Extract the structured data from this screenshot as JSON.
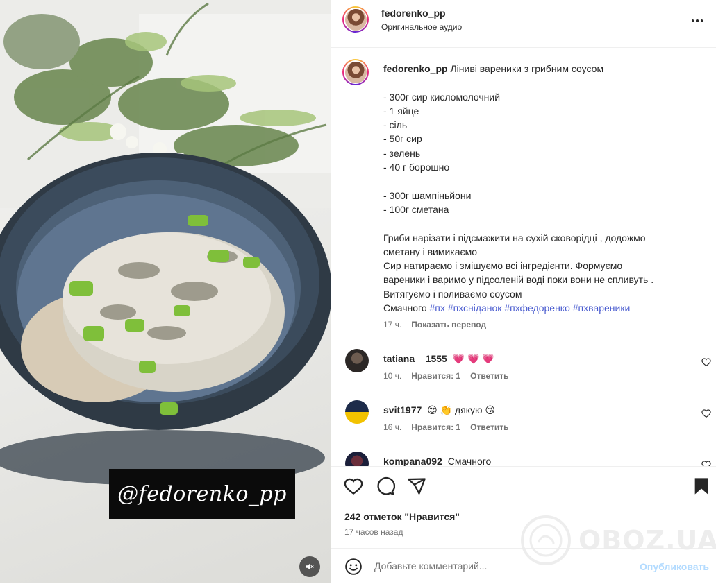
{
  "media": {
    "watermark": "@fedorenko_pp",
    "mute_icon": "speaker-muted-icon"
  },
  "header": {
    "username": "fedorenko_pp",
    "subline": "Оригинальное аудио",
    "more_icon": "more-horizontal-icon"
  },
  "caption": {
    "username": "fedorenko_pp",
    "title": "Ліниві вареники з грибним соусом",
    "lines": [
      "",
      "- 300г сир кисломолочний",
      "- 1 яйце",
      "- сіль",
      "- 50г сир",
      "- зелень",
      "- 40 г борошно",
      "",
      "- 300г шампіньйони",
      "- 100г сметана",
      "",
      "Гриби нарізати і підсмажити на сухій сковорідці , додожмо",
      "сметану і вимикаємо",
      "Сир натираємо і змішуємо всі інгредієнти. Формуємо",
      "вареники і варимо у підсоленій воді поки вони не спливуть .",
      "Витягуємо і поливаємо соусом"
    ],
    "last_line_text": "Смачного",
    "hashtags": [
      "#пх",
      "#пхсніданок",
      "#пхфедоренко",
      "#пхвареники"
    ],
    "time": "17 ч.",
    "translate": "Показать перевод"
  },
  "comments": [
    {
      "username": "tatiana__1555",
      "text": "💗 💗 💗",
      "time": "10 ч.",
      "likes": "Нравится: 1",
      "reply": "Ответить"
    },
    {
      "username": "svit1977",
      "text": "😍 👏 дякую 😘",
      "time": "16 ч.",
      "likes": "Нравится: 1",
      "reply": "Ответить"
    },
    {
      "username": "kompana092",
      "text": "Смачного"
    }
  ],
  "actions": {
    "like_icon": "heart-icon",
    "comment_icon": "comment-icon",
    "share_icon": "send-icon",
    "save_icon": "bookmark-icon",
    "likes": "242 отметок \"Нравится\"",
    "time_ago": "17 часов назад"
  },
  "comment_bar": {
    "emoji_icon": "emoji-icon",
    "placeholder": "Добавьте комментарий...",
    "publish": "Опубликовать"
  },
  "overlay": {
    "brand": "OBOZ.UA"
  },
  "colors": {
    "accent_link": "#00376b",
    "hashtag": "#4a5ccf",
    "publish_disabled": "#b3dbff",
    "muted_text": "#737373"
  }
}
